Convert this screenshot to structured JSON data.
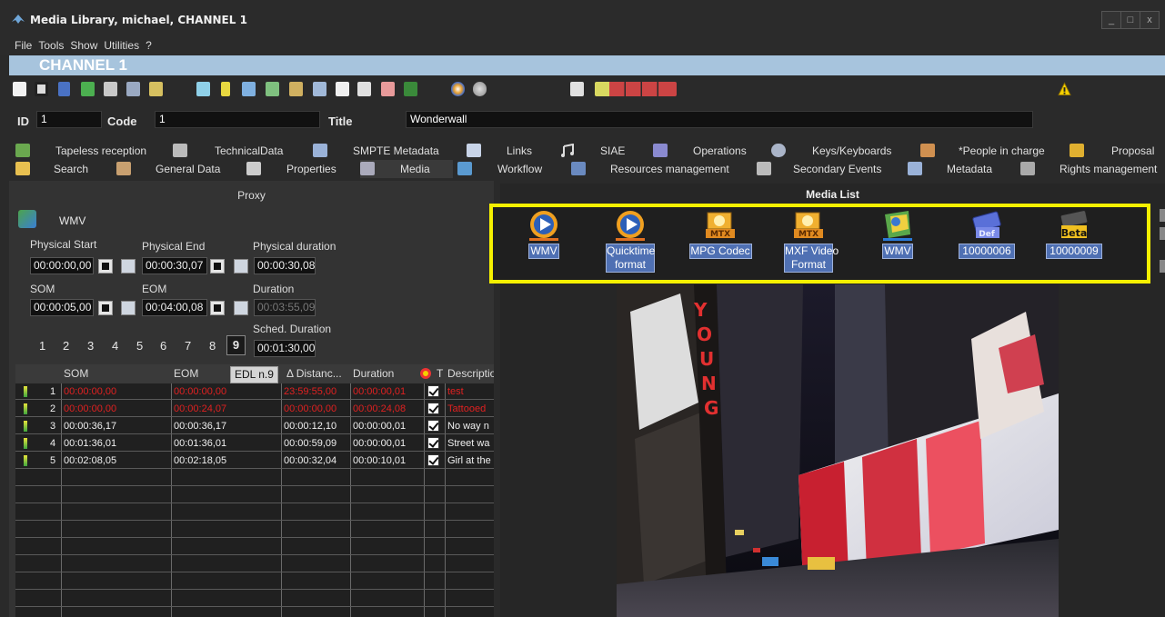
{
  "window": {
    "title": "Media Library, michael, CHANNEL 1",
    "controls": [
      "_",
      "□",
      "x"
    ]
  },
  "menu": [
    "File",
    "Tools",
    "Show",
    "Utilities",
    "?"
  ],
  "channel": "CHANNEL 1",
  "record": {
    "id_label": "ID",
    "id_value": "1",
    "code_label": "Code",
    "code_value": "1",
    "title_label": "Title",
    "title_value": "Wonderwall"
  },
  "tabs_row1": [
    "Tapeless reception",
    "TechnicalData",
    "SMPTE Metadata",
    "Links",
    "SIAE",
    "Operations",
    "Keys/Keyboards",
    "*People in charge",
    "Proposal"
  ],
  "tabs_row2": [
    "Search",
    "General Data",
    "Properties",
    "Media",
    "Workflow",
    "Resources management",
    "Secondary Events",
    "Metadata",
    "Rights management"
  ],
  "active_tab": "Media",
  "proxy": {
    "title": "Proxy",
    "format": "WMV",
    "physical_start_label": "Physical Start",
    "physical_start": "00:00:00,00",
    "physical_end_label": "Physical End",
    "physical_end": "00:00:30,07",
    "physical_duration_label": "Physical duration",
    "physical_duration": "00:00:30,08",
    "som_label": "SOM",
    "som": "00:00:05,00",
    "eom_label": "EOM",
    "eom": "00:04:00,08",
    "duration_label": "Duration",
    "duration": "00:03:55,09",
    "sched_duration_label": "Sched. Duration",
    "sched_duration": "00:01:30,00",
    "pages": [
      "1",
      "2",
      "3",
      "4",
      "5",
      "6",
      "7",
      "8",
      "9"
    ],
    "selected_page": "9"
  },
  "edl": {
    "tooltip": "EDL n.9",
    "columns": [
      "SOM",
      "EOM",
      "Δ Distanc...",
      "Duration",
      "T",
      "Descriptio"
    ],
    "rows": [
      {
        "n": "1",
        "som": "00:00:00,00",
        "eom": "00:00:00,00",
        "dist": "23:59:55,00",
        "dur": "00:00:00,01",
        "desc": "test",
        "red": true
      },
      {
        "n": "2",
        "som": "00:00:00,00",
        "eom": "00:00:24,07",
        "dist": "00:00:00,00",
        "dur": "00:00:24,08",
        "desc": "Tattooed",
        "red": true
      },
      {
        "n": "3",
        "som": "00:00:36,17",
        "eom": "00:00:36,17",
        "dist": "00:00:12,10",
        "dur": "00:00:00,01",
        "desc": "No way n",
        "red": false
      },
      {
        "n": "4",
        "som": "00:01:36,01",
        "eom": "00:01:36,01",
        "dist": "00:00:59,09",
        "dur": "00:00:00,01",
        "desc": "Street wa",
        "red": false
      },
      {
        "n": "5",
        "som": "00:02:08,05",
        "eom": "00:02:18,05",
        "dist": "00:00:32,04",
        "dur": "00:00:10,01",
        "desc": "Girl at the",
        "red": false
      }
    ]
  },
  "media_list": {
    "title": "Media List",
    "items": [
      {
        "label_line1": "WMV",
        "label_line2": "",
        "icon": "media-player-icon"
      },
      {
        "label_line1": "Quicktime",
        "label_line2": "format",
        "icon": "media-player-icon"
      },
      {
        "label_line1": "MPG Codec",
        "label_line2": "",
        "icon": "mtx-icon",
        "badge": "MTX"
      },
      {
        "label_line1": "MXF Video",
        "label_line2": "Format",
        "icon": "mtx-icon",
        "badge": "MTX"
      },
      {
        "label_line1": "WMV",
        "label_line2": "",
        "icon": "map-icon"
      },
      {
        "label_line1": "10000006",
        "label_line2": "",
        "icon": "tape-icon",
        "badge": "Def"
      },
      {
        "label_line1": "10000009",
        "label_line2": "",
        "icon": "betacam-icon",
        "badge": "Beta"
      }
    ]
  },
  "preview": {
    "billboard_letters": [
      "Y",
      "O",
      "U",
      "N",
      "G"
    ]
  },
  "colors": {
    "accent": "#a7c4dd",
    "highlight": "#f5f000",
    "label_bg": "#4f70b3",
    "red_text": "#e02020"
  }
}
